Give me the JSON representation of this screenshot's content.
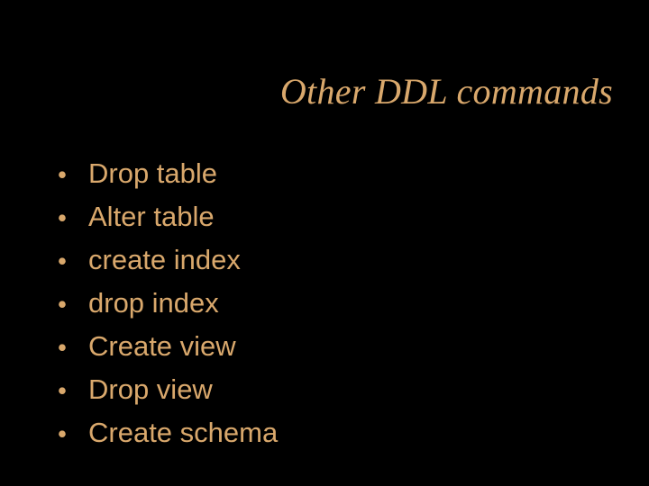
{
  "title": "Other DDL commands",
  "bullets": [
    "Drop table",
    "Alter table",
    "create index",
    "drop index",
    "Create view",
    "Drop view",
    "Create schema"
  ],
  "bullet_char": "•"
}
